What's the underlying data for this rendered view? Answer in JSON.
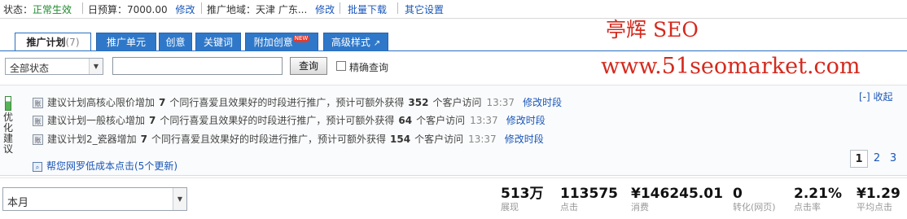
{
  "topbar": {
    "status_label": "状态：",
    "status_value": "正常生效",
    "budget_label": "日预算：",
    "budget_value": "7000.00",
    "budget_edit": "修改",
    "region_label": "推广地域：",
    "region_value": "天津 广东...",
    "region_edit": "修改",
    "batch_download": "批量下载",
    "other_settings": "其它设置"
  },
  "watermark": {
    "line1": "亭辉 SEO",
    "line2": "www.51seomarket.com"
  },
  "tabs": {
    "plan": "推广计划",
    "plan_count": "(7)",
    "unit": "推广单元",
    "creative": "创意",
    "keyword": "关键词",
    "extra_creative": "附加创意",
    "extra_badge": "NEW",
    "advanced": "高级样式"
  },
  "filter": {
    "status_select": "全部状态",
    "search_value": "",
    "search_button": "查询",
    "exact_label": "精确查询"
  },
  "suggestions": {
    "side_label": "优化建议",
    "collapse": "[-] 收起",
    "rows": [
      {
        "icon": "账",
        "plan": "建议计划高核心限价增加",
        "count": "7",
        "mid": "个同行喜爱且效果好的时段进行推广，预计可额外获得",
        "visits": "352",
        "tail": "个客户访问",
        "time": "13:37",
        "action": "修改时段"
      },
      {
        "icon": "账",
        "plan": "建议计划一般核心增加",
        "count": "7",
        "mid": "个同行喜爱且效果好的时段进行推广，预计可额外获得",
        "visits": "64",
        "tail": "个客户访问",
        "time": "13:37",
        "action": "修改时段"
      },
      {
        "icon": "账",
        "plan": "建议计划2_瓷器增加",
        "count": "7",
        "mid": "个同行喜爱且效果好的时段进行推广，预计可额外获得",
        "visits": "154",
        "tail": "个客户访问",
        "time": "13:37",
        "action": "修改时段"
      }
    ],
    "more_link": "帮您网罗低成本点击(5个更新)",
    "pages": [
      "1",
      "2",
      "3"
    ]
  },
  "period": {
    "value": "本月"
  },
  "metrics": [
    {
      "value": "513万",
      "label": "展现"
    },
    {
      "value": "113575",
      "label": "点击"
    },
    {
      "value": "¥146245.01",
      "label": "消费"
    },
    {
      "value": "0",
      "label": "转化(网页)"
    },
    {
      "value": "2.21%",
      "label": "点击率"
    },
    {
      "value": "¥1.29",
      "label": "平均点击"
    }
  ],
  "colors": {
    "accent_blue": "#2f78c9",
    "status_green": "#1d8a2e",
    "watermark_red": "#d42a1e",
    "link_blue": "#1a56b8"
  }
}
